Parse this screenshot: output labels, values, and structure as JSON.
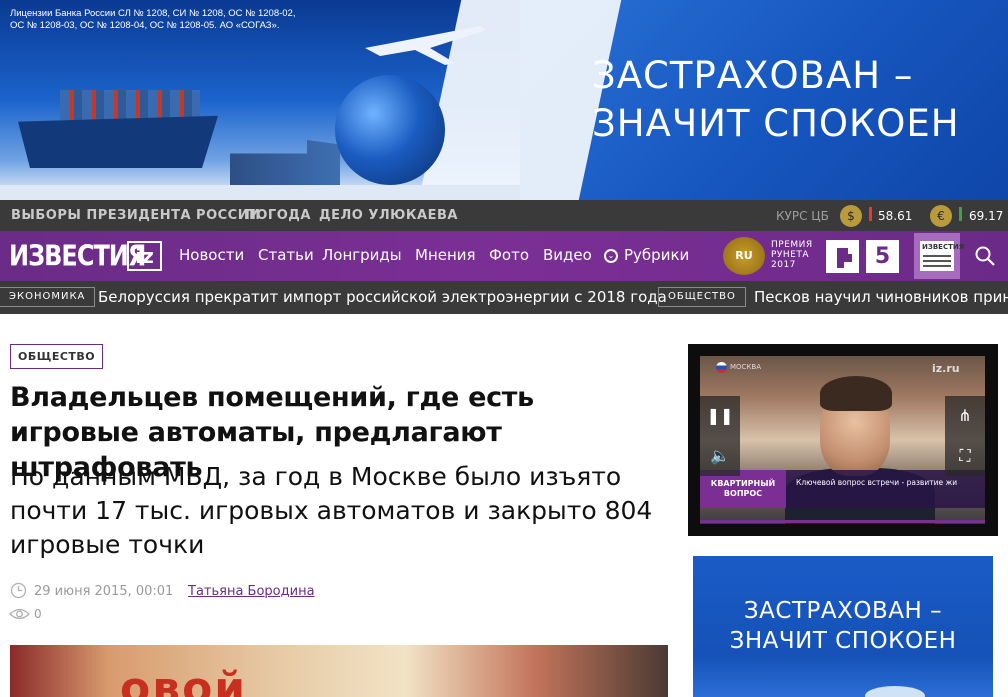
{
  "ad_banner": {
    "license_text": "Лицензии Банка России СЛ № 1208, СИ № 1208, ОС № 1208-02, ОС № 1208-03, ОС № 1208-04, ОС № 1208-05. АО «СОГАЗ».",
    "slogan_line1": "ЗАСТРАХОВАН –",
    "slogan_line2": "ЗНАЧИТ СПОКОЕН"
  },
  "topnav": {
    "links": [
      "ВЫБОРЫ ПРЕЗИДЕНТА РОССИИ",
      "ПОГОДА",
      "ДЕЛО УЛЮКАЕВА"
    ],
    "kurs_label": "КУРС ЦБ",
    "currencies": [
      {
        "symbol": "$",
        "value": "58.61",
        "trend": "down",
        "trend_color": "#e53935"
      },
      {
        "symbol": "€",
        "value": "69.17",
        "trend": "up",
        "trend_color": "#43a047"
      }
    ]
  },
  "mainnav": {
    "logo": "ИЗВЕСТИЯ",
    "logo_iz": "iz",
    "items": [
      "Новости",
      "Статьи",
      "Лонгриды",
      "Мнения",
      "Фото",
      "Видео",
      "Рубрики"
    ],
    "award_badge": "RU",
    "award_lines": [
      "ПРЕМИЯ",
      "РУНЕТА",
      "2017"
    ],
    "channel5": "5",
    "channel_tile_label": "ИЗВЕСТИЯ"
  },
  "ticker": [
    {
      "tag": "экономика",
      "headline": "Белоруссия прекратит импорт российской электроэнергии с 2018 года"
    },
    {
      "tag": "общество",
      "headline": "Песков научил чиновников прини"
    }
  ],
  "article": {
    "rubric": "ОБЩЕСТВО",
    "title": "Владельцев помещений, где есть игровые автоматы, предлагают штрафовать",
    "lead": "По данным МВД, за год в Москве было изъято почти 17 тыс. игровых автоматов и закрыто 804 игровые точки",
    "date": "29 июня 2015, 00:01",
    "author": "Татьяна Бородина",
    "views": "0",
    "photo_text": "овой"
  },
  "video": {
    "flag_label": "МОСКВА",
    "watermark": "iz.ru",
    "lower_left": "КВАРТИРНЫЙ ВОПРОС",
    "lower_right": "Ключевой вопрос встречи - развитие жи",
    "pause_glyph": "❚❚",
    "volume_glyph": "🔈",
    "share_glyph": "⋔",
    "fullscreen_glyph": "⛶"
  },
  "side_ad": {
    "slogan_line1": "ЗАСТРАХОВАН –",
    "slogan_line2": "ЗНАЧИТ СПОКОЕН"
  },
  "colors": {
    "brand_purple": "#6a2c86",
    "dark_bar": "#3a3a3a",
    "ad_blue": "#1656bf"
  }
}
